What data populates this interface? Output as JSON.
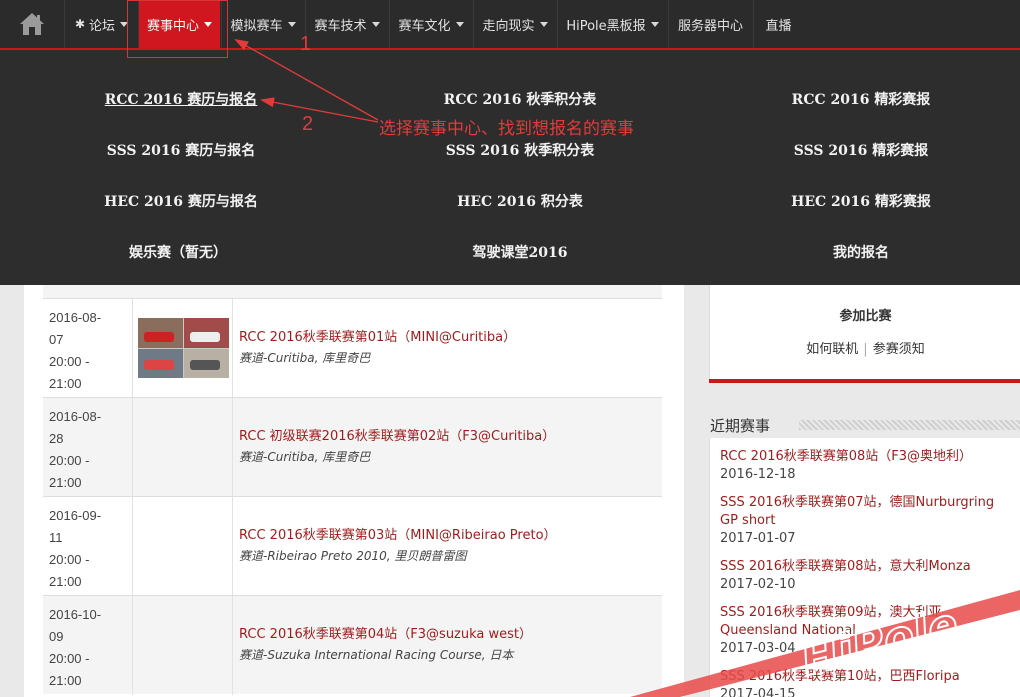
{
  "nav": {
    "items": [
      {
        "label": "论坛",
        "has_caret": true,
        "icon": "gear-icon"
      },
      {
        "label": "赛事中心",
        "has_caret": true,
        "active": true
      },
      {
        "label": "模拟赛车",
        "has_caret": true
      },
      {
        "label": "赛车技术",
        "has_caret": true
      },
      {
        "label": "赛车文化",
        "has_caret": true
      },
      {
        "label": "走向现实",
        "has_caret": true
      },
      {
        "label": "HiPole黑板报",
        "has_caret": true
      },
      {
        "label": "服务器中心",
        "has_caret": false
      },
      {
        "label": "直播",
        "has_caret": false
      }
    ],
    "home_icon": "home-icon",
    "gear_glyph": "✱"
  },
  "dropdown": {
    "links": [
      "RCC 2016 赛历与报名",
      "RCC 2016 秋季积分表",
      "RCC 2016 精彩赛报",
      "SSS 2016 赛历与报名",
      "SSS 2016 秋季积分表",
      "SSS 2016 精彩赛报",
      "HEC 2016 赛历与报名",
      "HEC 2016 积分表",
      "HEC 2016 精彩赛报",
      "娱乐赛（暂无）",
      "驾驶课堂2016",
      "我的报名"
    ]
  },
  "annotations": {
    "step1": "1",
    "step2": "2",
    "text": "选择赛事中心、找到想报名的赛事"
  },
  "events": [
    {
      "date": "2016-08-",
      "date2": "07",
      "time1": "20:00 -",
      "time2": "21:00",
      "title": "RCC 2016秋季联赛第01站（MINI@Curitiba）",
      "track": "赛道-Curitiba, 库里奇巴",
      "has_thumb": true
    },
    {
      "date": "2016-08-",
      "date2": "28",
      "time1": "20:00 -",
      "time2": "21:00",
      "title": "RCC 初级联赛2016秋季联赛第02站（F3@Curitiba）",
      "track": "赛道-Curitiba, 库里奇巴",
      "has_thumb": false
    },
    {
      "date": "2016-09-",
      "date2": "11",
      "time1": "20:00 -",
      "time2": "21:00",
      "title": "RCC 2016秋季联赛第03站（MINI@Ribeirao Preto）",
      "track": "赛道-Ribeirao Preto 2010, 里贝朗普雷图",
      "has_thumb": false
    },
    {
      "date": "2016-10-",
      "date2": "09",
      "time1": "20:00 -",
      "time2": "21:00",
      "title": "RCC 2016秋季联赛第04站（F3@suzuka west）",
      "track": "赛道-Suzuka International Racing Course, 日本",
      "has_thumb": false
    }
  ],
  "sidebar": {
    "join_title": "参加比赛",
    "link_connect": "如何联机",
    "link_rules": "参赛须知",
    "recent_title": "近期赛事",
    "recent": [
      {
        "name": "RCC 2016秋季联赛第08站（F3@奥地利）",
        "date": "2016-12-18"
      },
      {
        "name": "SSS 2016秋季联赛第07站，德国Nurburgring GP short",
        "date": "2017-01-07"
      },
      {
        "name": "SSS 2016秋季联赛第08站，意大利Monza",
        "date": "2017-02-10"
      },
      {
        "name": "SSS 2016秋季联赛第09站，澳大利亚 Queensland National",
        "date": "2017-03-04"
      },
      {
        "name": "SSS 2016秋季联赛第10站，巴西Floripa",
        "date": "2017-04-15"
      }
    ]
  },
  "watermark": {
    "text": "HiPole"
  },
  "colors": {
    "nav_bg": "#2b2b2b",
    "accent": "#c8171e",
    "annotation": "#e23b3b",
    "link_red": "#9e1b1b"
  }
}
